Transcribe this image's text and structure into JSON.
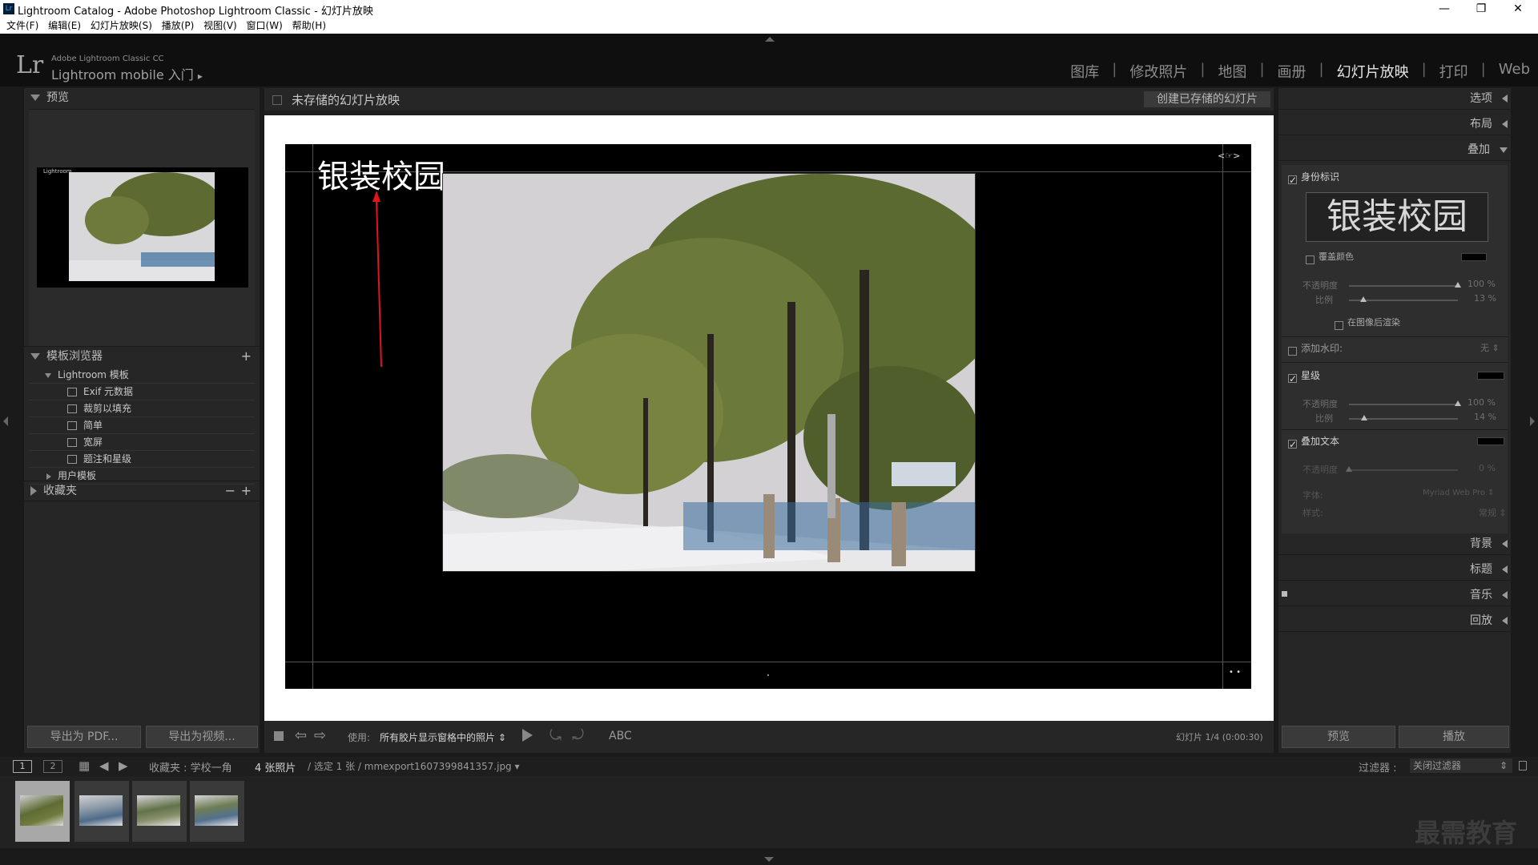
{
  "window": {
    "title": "Lightroom Catalog - Adobe Photoshop Lightroom Classic - 幻灯片放映",
    "app_icon": "Lr",
    "min": "—",
    "restore": "❐",
    "close": "✕"
  },
  "menu": [
    "文件(F)",
    "编辑(E)",
    "幻灯片放映(S)",
    "播放(P)",
    "视图(V)",
    "窗口(W)",
    "帮助(H)"
  ],
  "identity": {
    "logo": "Lr",
    "line1": "Adobe Lightroom Classic CC",
    "line2": "Lightroom mobile 入门",
    "arrow": "▸"
  },
  "modules": {
    "items": [
      "图库",
      "修改照片",
      "地图",
      "画册",
      "幻灯片放映",
      "打印",
      "Web"
    ],
    "active_index": 4,
    "separator": "|"
  },
  "left_panel": {
    "preview_title": "预览",
    "preview_label": "Lightroom",
    "template_browser_title": "模板浏览器",
    "add": "+",
    "lightroom_templates_label": "Lightroom 模板",
    "templates": [
      "Exif 元数据",
      "裁剪以填充",
      "简单",
      "宽屏",
      "题注和星级"
    ],
    "user_templates_label": "用户模板",
    "collections_title": "收藏夹",
    "minus": "−",
    "export_pdf": "导出为 PDF...",
    "export_video": "导出为视频..."
  },
  "center": {
    "header_title": "未存储的幻灯片放映",
    "create_saved": "创建已存储的幻灯片",
    "identity_text": "银装校园",
    "corner_icon": "<☞>",
    "dots": "• •"
  },
  "toolbar": {
    "use_label": "使用:",
    "use_value": "所有胶片显示窗格中的照片",
    "abc": "ABC",
    "slide_info": "幻灯片 1/4 (0:00:30)"
  },
  "right_panel": {
    "options": "选项",
    "layout": "布局",
    "overlays": "叠加",
    "identity_plate_label": "身份标识",
    "identity_plate_checked": true,
    "identity_plate_text": "银装校园",
    "override_color": "覆盖颜色",
    "override_checked": false,
    "opacity_label": "不透明度",
    "scale_label": "比例",
    "plate_opacity": "100",
    "plate_opacity_value": 1.0,
    "plate_scale": "13",
    "plate_scale_value": 0.13,
    "render_behind": "在图像后渲染",
    "render_behind_checked": false,
    "watermark_label": "添加水印:",
    "watermark_checked": false,
    "watermark_value": "无",
    "rating_label": "星级",
    "rating_checked": true,
    "rating_opacity": "100",
    "rating_opacity_value": 1.0,
    "rating_scale": "14",
    "rating_scale_value": 0.14,
    "text_overlay_label": "叠加文本",
    "text_overlay_checked": true,
    "text_opacity": "0",
    "text_opacity_value": 0.0,
    "font_label": "字体:",
    "font_value": "Myriad Web Pro",
    "style_label": "样式:",
    "style_value": "常规",
    "pct": "%",
    "background": "背景",
    "titles": "标题",
    "music": "音乐",
    "playback": "回放",
    "preview_btn": "预览",
    "play_btn": "播放"
  },
  "filmstrip": {
    "page1": "1",
    "page2": "2",
    "collection": "收藏夹 : 学校一角",
    "count": "4 张照片",
    "selection": "/ 选定 1 张 / mmexport1607399841357.jpg",
    "filter_label": "过滤器 :",
    "filter_value": "关闭过滤器",
    "thumb_count": 4,
    "selected_index": 0
  },
  "watermark": "最需教育",
  "colors": {
    "panel_bg": "#262626",
    "center_bg": "#1e1e1e",
    "annotation_red": "#e0151b",
    "active_module": "#e6e6e6"
  }
}
